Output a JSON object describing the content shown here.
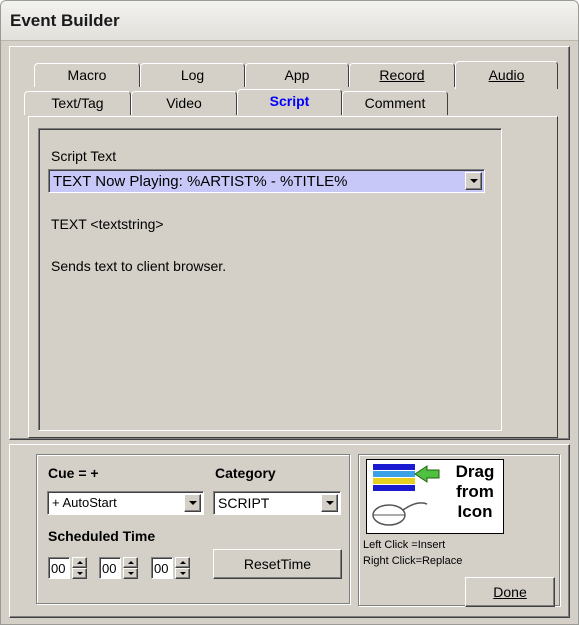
{
  "window": {
    "title": "Event Builder"
  },
  "tabs": {
    "row_back": [
      "Macro",
      "Log",
      "App",
      "Record",
      "Audio"
    ],
    "row_front": [
      "Text/Tag",
      "Video",
      "Script",
      "Comment"
    ],
    "selected": "Script"
  },
  "script": {
    "label": "Script Text",
    "value": "TEXT Now Playing: %ARTIST% - %TITLE%",
    "syntax": "TEXT <textstring>",
    "description": "Sends text to client browser."
  },
  "cue": {
    "label": "Cue = +",
    "value": "+ AutoStart"
  },
  "category": {
    "label": "Category",
    "value": "SCRIPT"
  },
  "scheduled": {
    "label": "Scheduled Time",
    "hours": "00",
    "minutes": "00",
    "seconds": "00",
    "reset_label": "ResetTime"
  },
  "drag": {
    "line1": "Drag",
    "line2": "from",
    "line3": "Icon",
    "help1": "Left Click  =Insert",
    "help2": "Right Click=Replace"
  },
  "done_label": "Done",
  "icons": [
    "list-arrow-icon",
    "mouse-icon",
    "dropdown-arrow-icon",
    "spin-up-icon",
    "spin-down-icon"
  ],
  "colors": {
    "selected_tab": "#0000ff",
    "script_field_bg": "#c8c8f8",
    "face": "#d4d0c8"
  }
}
